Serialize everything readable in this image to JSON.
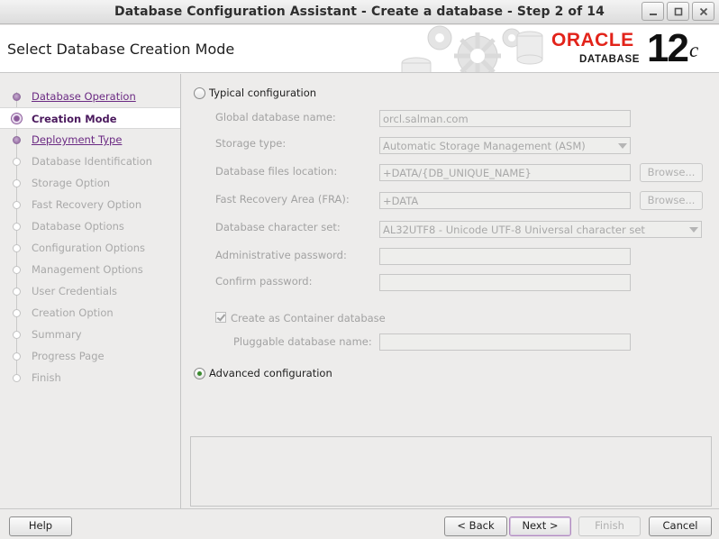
{
  "window": {
    "title": "Database Configuration Assistant - Create a database - Step 2 of 14",
    "controls": [
      "minimize-icon",
      "maximize-icon",
      "close-icon"
    ]
  },
  "header": {
    "page_title": "Select Database Creation Mode",
    "logo_oracle": "ORACLE",
    "logo_database": "DATABASE",
    "logo_version": "12",
    "logo_version_suffix": "c"
  },
  "nav": {
    "items": [
      {
        "label": "Database Operation",
        "state": "done"
      },
      {
        "label": "Creation Mode",
        "state": "current"
      },
      {
        "label": "Deployment Type",
        "state": "done"
      },
      {
        "label": "Database Identification",
        "state": "pending"
      },
      {
        "label": "Storage Option",
        "state": "pending"
      },
      {
        "label": "Fast Recovery Option",
        "state": "pending"
      },
      {
        "label": "Database Options",
        "state": "pending"
      },
      {
        "label": "Configuration Options",
        "state": "pending"
      },
      {
        "label": "Management Options",
        "state": "pending"
      },
      {
        "label": "User Credentials",
        "state": "pending"
      },
      {
        "label": "Creation Option",
        "state": "pending"
      },
      {
        "label": "Summary",
        "state": "pending"
      },
      {
        "label": "Progress Page",
        "state": "pending"
      },
      {
        "label": "Finish",
        "state": "pending"
      }
    ]
  },
  "main": {
    "typical": {
      "label": "Typical configuration",
      "selected": false,
      "global_db_name_label": "Global database name:",
      "global_db_name_value": "orcl.salman.com",
      "storage_type_label": "Storage type:",
      "storage_type_value": "Automatic Storage Management (ASM)",
      "db_files_location_label": "Database files location:",
      "db_files_location_value": "+DATA/{DB_UNIQUE_NAME}",
      "fra_label": "Fast Recovery Area (FRA):",
      "fra_value": "+DATA",
      "browse_label": "Browse...",
      "charset_label": "Database character set:",
      "charset_value": "AL32UTF8 - Unicode UTF-8 Universal character set",
      "admin_pw_label": "Administrative password:",
      "admin_pw_value": "",
      "confirm_pw_label": "Confirm password:",
      "confirm_pw_value": "",
      "container_label": "Create as Container database",
      "container_checked": true,
      "pdb_name_label": "Pluggable database name:",
      "pdb_name_value": ""
    },
    "advanced": {
      "label": "Advanced configuration",
      "selected": true
    }
  },
  "footer": {
    "help": "Help",
    "back": "< Back",
    "next": "Next >",
    "finish": "Finish",
    "cancel": "Cancel"
  }
}
